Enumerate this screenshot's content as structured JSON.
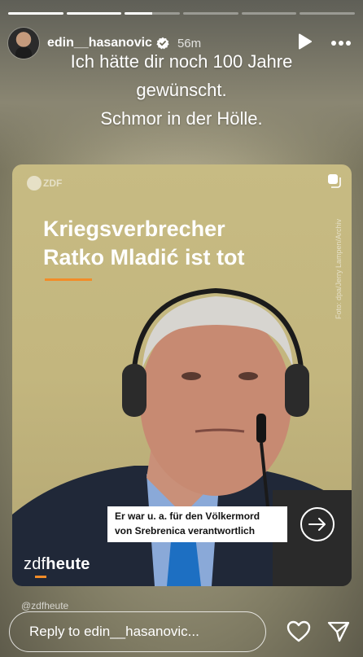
{
  "story": {
    "segments_total": 6,
    "segment_progress": [
      1,
      1,
      0.5,
      0,
      0,
      0
    ]
  },
  "header": {
    "username": "edin__hasanovic",
    "time": "56m",
    "icons": [
      "verified-badge-icon",
      "play-icon",
      "more-icon"
    ]
  },
  "caption": {
    "lines": [
      "Ich hätte dir noch 100 Jahre",
      "gewünscht.",
      "Schmor in der Hölle."
    ]
  },
  "post": {
    "logo_text": "ZDF",
    "headline_line1": "Kriegsverbrecher",
    "headline_line2": "Ratko Mladić ist tot",
    "photo_credit": "Foto: dpa/Jerry Lampen/Archiv",
    "subtitle_line1": "Er war u. a. für den Völkermord",
    "subtitle_line2": "von Srebrenica verantwortlich",
    "brand_zdf": "zdf",
    "brand_heute": "heute",
    "accent_color": "#f28c28"
  },
  "footer": {
    "mention": "@zdfheute",
    "reply_placeholder": "Reply to edin__hasanovic...",
    "icons": [
      "heart-icon",
      "send-icon"
    ]
  }
}
